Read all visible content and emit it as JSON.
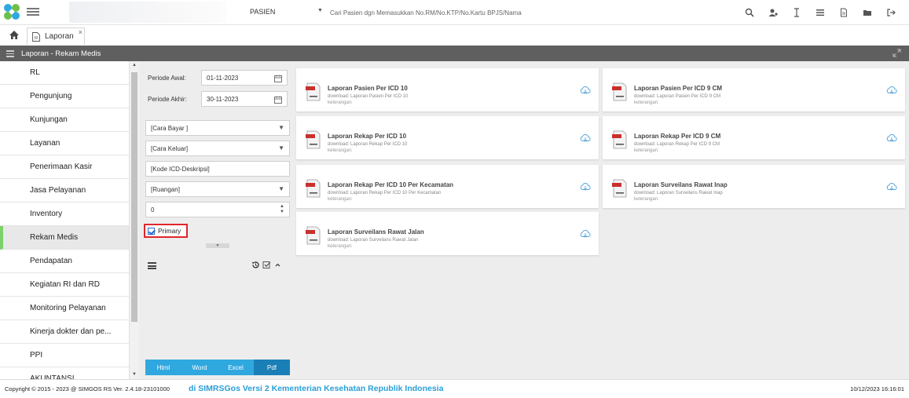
{
  "topbar": {
    "module": "PASIEN",
    "search_placeholder": "Cari Pasien dgn Memasukkan No.RM/No.KTP/No.Kartu BPJS/Nama",
    "icons": [
      "search-icon",
      "user-settings-icon",
      "text-cursor-icon",
      "list-icon",
      "document-icon",
      "folder-icon",
      "logout-icon"
    ]
  },
  "tabs": [
    {
      "label": "Laporan",
      "close": "×"
    }
  ],
  "panel": {
    "title": "Laporan - Rekam Medis"
  },
  "sidebar": {
    "items": [
      {
        "label": "RL"
      },
      {
        "label": "Pengunjung"
      },
      {
        "label": "Kunjungan"
      },
      {
        "label": "Layanan"
      },
      {
        "label": "Penerimaan Kasir"
      },
      {
        "label": "Jasa Pelayanan"
      },
      {
        "label": "Inventory"
      },
      {
        "label": "Rekam Medis",
        "active": true
      },
      {
        "label": "Pendapatan"
      },
      {
        "label": "Kegiatan RI dan RD"
      },
      {
        "label": "Monitoring Pelayanan"
      },
      {
        "label": "Kinerja dokter dan pe..."
      },
      {
        "label": "PPI"
      },
      {
        "label": "AKUNTANSI"
      }
    ]
  },
  "filters": {
    "periode_awal_label": "Periode Awal:",
    "periode_awal_value": "01-11-2023",
    "periode_akhir_label": "Periode Akhir:",
    "periode_akhir_value": "30-11-2023",
    "cara_bayar": "[Cara Bayar ]",
    "cara_keluar": "[Cara Keluar]",
    "kode_icd": "[Kode ICD-Deskripsi]",
    "ruangan": "[Ruangan]",
    "number_value": "0",
    "primary_label": "Primary",
    "primary_checked": true
  },
  "export": {
    "html": "Html",
    "word": "Word",
    "excel": "Excel",
    "pdf": "Pdf"
  },
  "reports": [
    {
      "title": "Laporan Pasien Per ICD 10",
      "sub": "download: Laporan Pasien Per ICD 10",
      "desc": "keterangan:"
    },
    {
      "title": "Laporan Pasien Per ICD 9 CM",
      "sub": "download: Laporan Pasien Per ICD 9 CM",
      "desc": "keterangan:"
    },
    {
      "title": "Laporan Rekap Per ICD 10",
      "sub": "download: Laporan Rekap Per ICD 10",
      "desc": "keterangan:"
    },
    {
      "title": "Laporan Rekap Per ICD 9 CM",
      "sub": "download: Laporan Rekap Per ICD 9 CM",
      "desc": "keterangan:"
    },
    {
      "title": "Laporan Rekap Per ICD 10 Per Kecamatan",
      "sub": "download: Laporan Rekap Per ICD 10 Per Kecamatan",
      "desc": "keterangan:"
    },
    {
      "title": "Laporan Surveilans Rawat Inap",
      "sub": "download: Laporan Surveilans Rawat Inap",
      "desc": "keterangan:"
    },
    {
      "title": "Laporan Surveilans Rawat Jalan",
      "sub": "download: Laporan Surveilans Rawat Jalan",
      "desc": "keterangan:"
    }
  ],
  "footer": {
    "copyright": "Copyright © 2015 - 2023 @ SIMGOS RS Ver. 2.4.18-23101000",
    "marquee": "di SIMRSGos Versi 2 Kementerian Kesehatan Republik Indonesia",
    "datetime": "10/12/2023 16:16:01"
  },
  "colors": {
    "accent_blue": "#2fa8e0",
    "active_green": "#7bd16b",
    "highlight_red": "#e0262b",
    "header_gray": "#5f5f5f"
  }
}
